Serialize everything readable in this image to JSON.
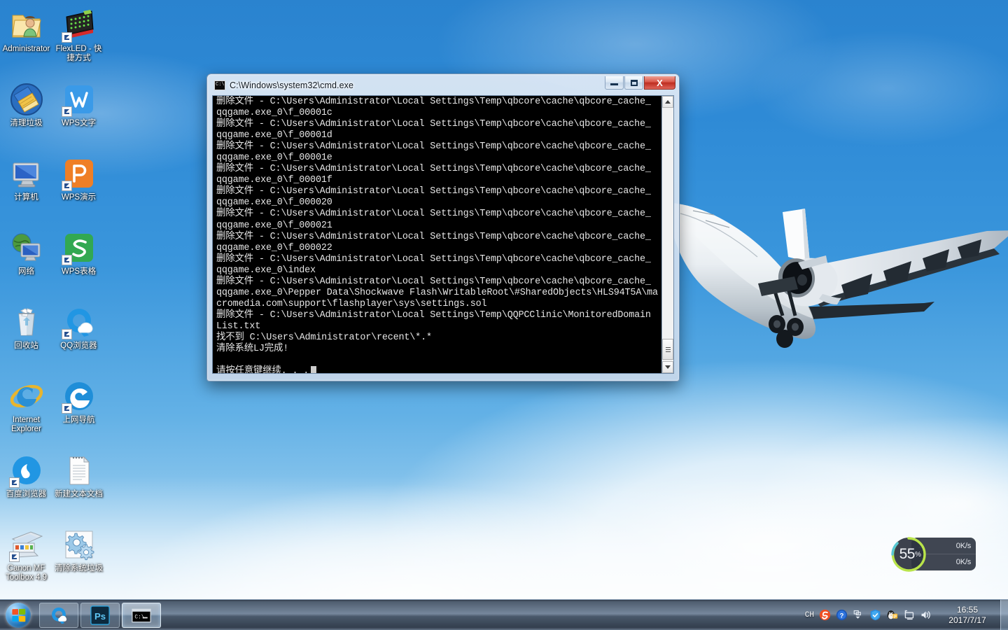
{
  "desktop": {
    "icons": [
      {
        "label": "Administrator",
        "icon": "user-folder-icon",
        "shortcut": false
      },
      {
        "label": "FlexLED - 快捷方式",
        "icon": "flexled-icon",
        "shortcut": true
      },
      {
        "label": "清理垃圾",
        "icon": "broom-cleanup-icon",
        "shortcut": false
      },
      {
        "label": "WPS文字",
        "icon": "wps-writer-icon",
        "shortcut": true
      },
      {
        "label": "计算机",
        "icon": "computer-icon",
        "shortcut": false
      },
      {
        "label": "WPS演示",
        "icon": "wps-presentation-icon",
        "shortcut": true
      },
      {
        "label": "网络",
        "icon": "network-icon",
        "shortcut": false
      },
      {
        "label": "WPS表格",
        "icon": "wps-spreadsheet-icon",
        "shortcut": true
      },
      {
        "label": "回收站",
        "icon": "recycle-bin-icon",
        "shortcut": false
      },
      {
        "label": "QQ浏览器",
        "icon": "qq-browser-icon",
        "shortcut": true
      },
      {
        "label": "Internet Explorer",
        "icon": "internet-explorer-icon",
        "shortcut": false
      },
      {
        "label": "上网导航",
        "icon": "web-navigation-icon",
        "shortcut": true
      },
      {
        "label": "百度浏览器",
        "icon": "baidu-browser-icon",
        "shortcut": true
      },
      {
        "label": "新建文本文档",
        "icon": "text-document-icon",
        "shortcut": false
      },
      {
        "label": "Canon MF Toolbox 4.9",
        "icon": "canon-mf-toolbox-icon",
        "shortcut": true
      },
      {
        "label": "清除系统垃圾",
        "icon": "gears-cleanup-icon",
        "shortcut": false
      }
    ]
  },
  "cmd_window": {
    "title": "C:\\Windows\\system32\\cmd.exe",
    "icon": "cmd-icon",
    "buttons": {
      "minimize": "minimize",
      "maximize": "maximize",
      "close": "X"
    },
    "console_text": "删除文件 - C:\\Users\\Administrator\\Local Settings\\Temp\\qbcore\\cache\\qbcore_cache_\nqqgame.exe_0\\f_00001c\n删除文件 - C:\\Users\\Administrator\\Local Settings\\Temp\\qbcore\\cache\\qbcore_cache_\nqqgame.exe_0\\f_00001d\n删除文件 - C:\\Users\\Administrator\\Local Settings\\Temp\\qbcore\\cache\\qbcore_cache_\nqqgame.exe_0\\f_00001e\n删除文件 - C:\\Users\\Administrator\\Local Settings\\Temp\\qbcore\\cache\\qbcore_cache_\nqqgame.exe_0\\f_00001f\n删除文件 - C:\\Users\\Administrator\\Local Settings\\Temp\\qbcore\\cache\\qbcore_cache_\nqqgame.exe_0\\f_000020\n删除文件 - C:\\Users\\Administrator\\Local Settings\\Temp\\qbcore\\cache\\qbcore_cache_\nqqgame.exe_0\\f_000021\n删除文件 - C:\\Users\\Administrator\\Local Settings\\Temp\\qbcore\\cache\\qbcore_cache_\nqqgame.exe_0\\f_000022\n删除文件 - C:\\Users\\Administrator\\Local Settings\\Temp\\qbcore\\cache\\qbcore_cache_\nqqgame.exe_0\\index\n删除文件 - C:\\Users\\Administrator\\Local Settings\\Temp\\qbcore\\cache\\qbcore_cache_\nqqgame.exe_0\\Pepper Data\\Shockwave Flash\\WritableRoot\\#SharedObjects\\HLS94T5A\\ma\ncromedia.com\\support\\flashplayer\\sys\\settings.sol\n删除文件 - C:\\Users\\Administrator\\Local Settings\\Temp\\QQPCClinic\\MonitoredDomain\nList.txt\n找不到 C:\\Users\\Administrator\\recent\\*.*\n清除系统LJ完成!\n\n请按任意键继续. . .",
    "scrollbar": {
      "up_arrow": "▲",
      "down_arrow": "▼"
    }
  },
  "netspeed_widget": {
    "percent": "55",
    "percent_unit": "%",
    "upload_speed": "0K/s",
    "download_speed": "0K/s",
    "ring_color": "#b9e44a",
    "panel_color": "#262c3a"
  },
  "taskbar": {
    "start_button": "start-orb",
    "task_buttons": [
      {
        "name": "qq-browser",
        "icon": "qq-browser-icon",
        "active": false
      },
      {
        "name": "photoshop",
        "icon": "photoshop-icon",
        "label": "Ps",
        "active": false
      },
      {
        "name": "cmd",
        "icon": "cmd-icon",
        "active": true
      }
    ],
    "tray": {
      "language_indicator": "CH",
      "icons": [
        "sogou-input-icon",
        "help-question-icon",
        "show-hidden-icons-icon",
        "tencent-pc-manager-icon",
        "qq-penguin-icon",
        "network-monitor-icon",
        "volume-speaker-icon"
      ],
      "time": "16:55",
      "date": "2017/7/17"
    }
  }
}
